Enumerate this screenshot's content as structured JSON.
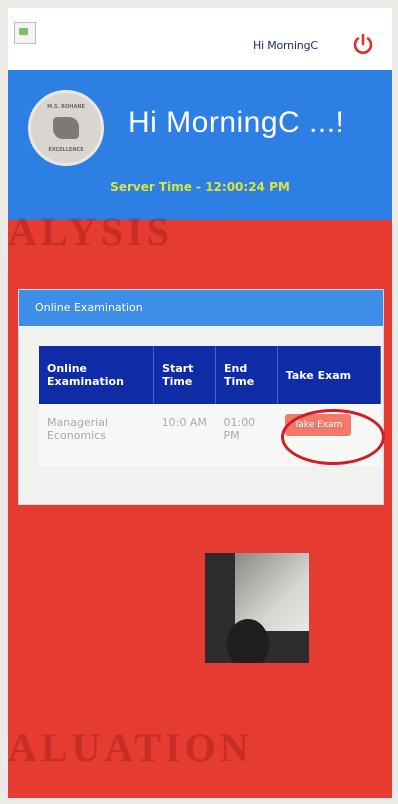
{
  "topbar": {
    "username": "Hi MorningC",
    "power_icon": "power-icon"
  },
  "header": {
    "logo_text_top": "M.S. ROHANE",
    "logo_text_bottom": "EXCELLENCE",
    "greeting": "Hi MorningC ...!",
    "server_time": "Server Time - 12:00:24 PM"
  },
  "background_text": {
    "top": "ALYSIS",
    "bottom": "ALUATION"
  },
  "exam_card": {
    "title": "Online Examination",
    "columns": [
      "Online Examination",
      "Start Time",
      "End Time",
      "Take Exam"
    ],
    "row": {
      "exam": "Managerial Economics",
      "start": "10:0 AM",
      "end": "01:00 PM",
      "button": "Take Exam"
    }
  },
  "colors": {
    "page_bg": "#e53b30",
    "header_blue": "#2e7fe3",
    "table_head": "#0f2ca6",
    "button": "#f0796a",
    "server_time": "#d9e63a"
  }
}
